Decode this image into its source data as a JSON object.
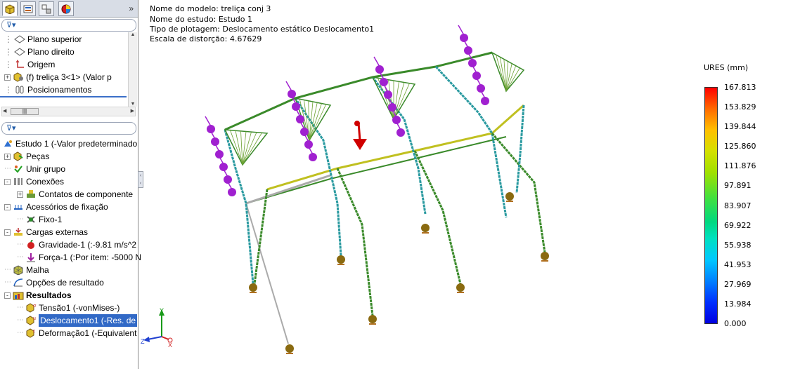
{
  "sidebar": {
    "tabs": [
      "feature-manager-icon",
      "property-manager-icon",
      "configuration-manager-icon",
      "display-manager-icon"
    ],
    "chevron": "»",
    "filter1": "",
    "filter2": "",
    "top_items": [
      {
        "label": "Plano superior",
        "icon": "plane-icon"
      },
      {
        "label": "Plano direito",
        "icon": "plane-icon"
      },
      {
        "label": "Origem",
        "icon": "origin-icon"
      },
      {
        "label": "(f) treliça 3<1> (Valor p",
        "icon": "assembly-part-icon"
      },
      {
        "label": "Posicionamentos",
        "icon": "mates-icon"
      }
    ],
    "study_items": [
      {
        "label": "Estudo 1 (-Valor predeterminado",
        "icon": "study-icon",
        "level": 0
      },
      {
        "label": "Peças",
        "icon": "parts-icon",
        "level": 1,
        "expander": "+"
      },
      {
        "label": "Unir grupo",
        "icon": "connect-group-icon",
        "level": 1
      },
      {
        "label": "Conexões",
        "icon": "connections-icon",
        "level": 1,
        "expander": "-"
      },
      {
        "label": "Contatos de componente",
        "icon": "contact-icon",
        "level": 2,
        "expander": "+"
      },
      {
        "label": "Acessórios de fixação",
        "icon": "fixture-icon",
        "level": 1,
        "expander": "-"
      },
      {
        "label": "Fixo-1",
        "icon": "fixed-icon",
        "level": 2
      },
      {
        "label": "Cargas externas",
        "icon": "external-loads-icon",
        "level": 1,
        "expander": "-"
      },
      {
        "label": "Gravidade-1 (:-9.81 m/s^2",
        "icon": "gravity-icon",
        "level": 2
      },
      {
        "label": "Força-1 (:Por item: -5000 N",
        "icon": "force-icon",
        "level": 2
      },
      {
        "label": "Malha",
        "icon": "mesh-icon",
        "level": 1
      },
      {
        "label": "Opções de resultado",
        "icon": "result-options-icon",
        "level": 1
      },
      {
        "label": "Resultados",
        "icon": "results-folder-icon",
        "level": 1,
        "expander": "-",
        "bold": true
      },
      {
        "label": "Tensão1 (-vonMises-)",
        "icon": "stress-plot-icon",
        "level": 2
      },
      {
        "label": "Deslocamento1 (-Res. de",
        "icon": "displacement-plot-icon",
        "level": 2,
        "selected": true
      },
      {
        "label": "Deformação1 (-Equivalent",
        "icon": "strain-plot-icon",
        "level": 2
      }
    ]
  },
  "viewport": {
    "info_lines": [
      "Nome do modelo: treliça conj 3",
      "Nome do estudo: Estudo 1",
      "Tipo de plotagem: Deslocamento estático Deslocamento1",
      "Escala de distorção: 4.67629"
    ],
    "legend": {
      "title": "URES (mm)",
      "values": [
        "167.813",
        "153.829",
        "139.844",
        "125.860",
        "111.876",
        "97.891",
        "83.907",
        "69.922",
        "55.938",
        "41.953",
        "27.969",
        "13.984",
        "0.000"
      ]
    },
    "triad": {
      "y": "Y",
      "z": "Z",
      "x": "X"
    },
    "colors": {
      "frame_green": "#3a8a2a",
      "frame_yellow": "#c0c020",
      "load_purple": "#a020d0",
      "fixture_brown": "#8a6a10",
      "arrow_red": "#d00000"
    }
  }
}
